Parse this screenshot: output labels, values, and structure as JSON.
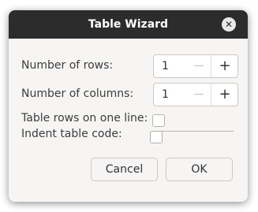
{
  "dialog": {
    "title": "Table Wizard",
    "close_icon": "close-icon"
  },
  "fields": {
    "rows_label": "Number of rows:",
    "rows_value": "1",
    "columns_label": "Number of columns:",
    "columns_value": "1",
    "one_line_label": "Table rows on one line:",
    "one_line_checked": false,
    "indent_label": "Indent table code:",
    "indent_checked": false
  },
  "spin_symbols": {
    "minus": "—",
    "plus": "+"
  },
  "buttons": {
    "cancel_label": "Cancel",
    "ok_label": "OK"
  },
  "colors": {
    "titlebar": "#2c2c2c",
    "background": "#f6f5f4"
  }
}
